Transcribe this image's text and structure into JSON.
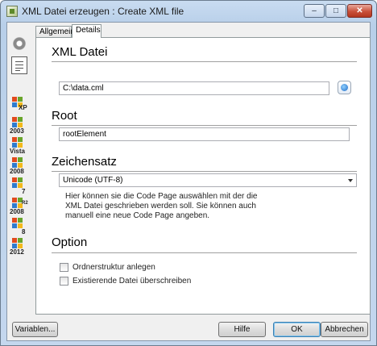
{
  "window": {
    "title": "XML Datei erzeugen : Create XML file",
    "controls": {
      "minimize": "–",
      "maximize": "□",
      "close": "✕"
    }
  },
  "nav": {
    "icons": [
      "circle-icon",
      "document-icon"
    ],
    "os_items": [
      "XP",
      "2003",
      "Vista",
      "2008",
      "7",
      "2008",
      "8",
      "2012"
    ],
    "os_item_extra": {
      "5": "R2"
    }
  },
  "tabs": [
    {
      "label": "Allgemein",
      "active": false
    },
    {
      "label": "Details",
      "active": true
    }
  ],
  "sections": {
    "xml_datei": {
      "heading": "XML Datei",
      "path_value": "C:\\data.cml"
    },
    "root": {
      "heading": "Root",
      "value": "rootElement"
    },
    "zeichensatz": {
      "heading": "Zeichensatz",
      "selected": "Unicode (UTF-8)",
      "help": "Hier können sie die Code Page auswählen mit der die XML Datei geschrieben werden soll. Sie können auch manuell eine neue Code Page angeben."
    },
    "option": {
      "heading": "Option",
      "checkboxes": [
        {
          "label": "Ordnerstruktur anlegen",
          "checked": false
        },
        {
          "label": "Existierende Datei überschreiben",
          "checked": false
        }
      ]
    }
  },
  "buttons": {
    "variables": "Variablen...",
    "help": "Hilfe",
    "ok": "OK",
    "cancel": "Abbrechen"
  },
  "colors": {
    "accent": "#3c7fb1",
    "close": "#c9503a"
  }
}
